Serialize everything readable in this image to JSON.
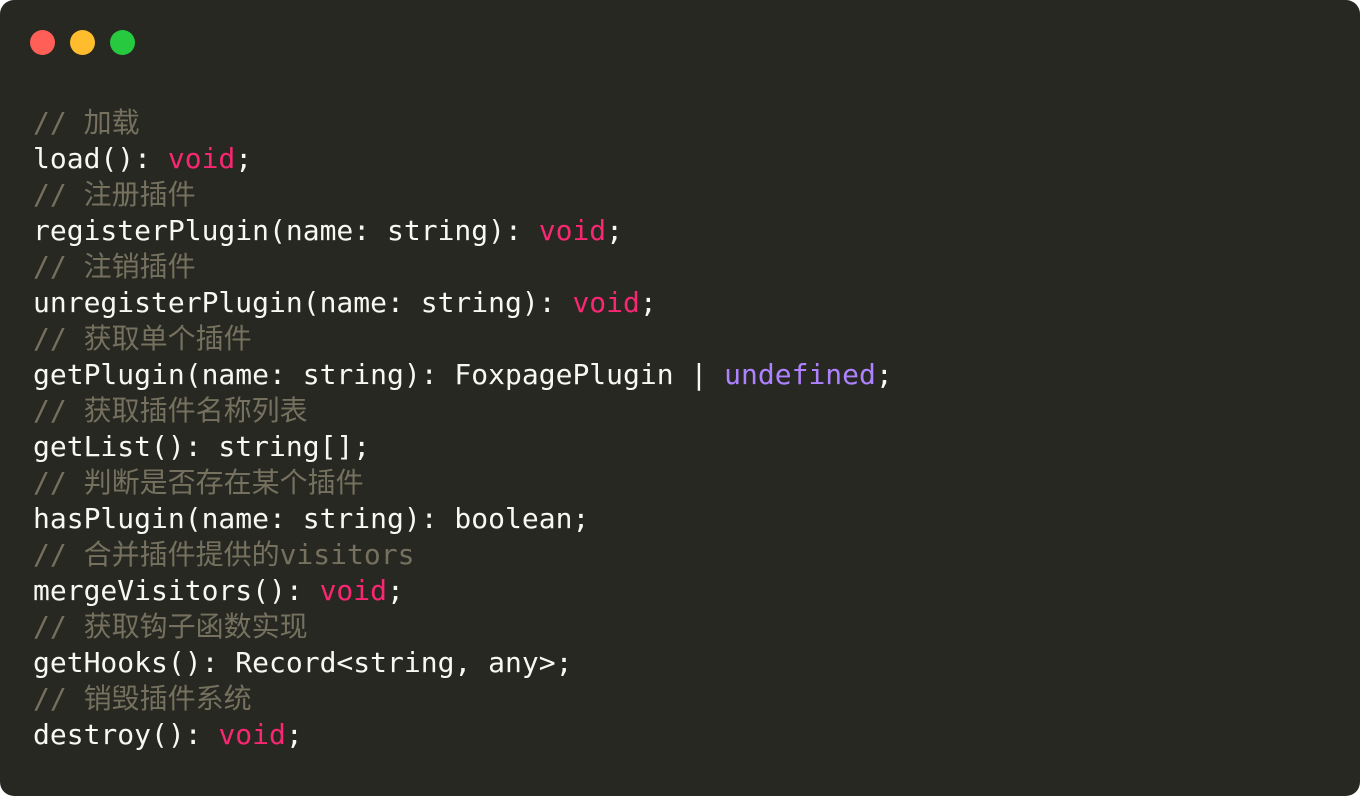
{
  "window": {
    "background": "#272822",
    "buttons": [
      {
        "name": "close",
        "color": "#ff5f56"
      },
      {
        "name": "minimize",
        "color": "#ffbd2e"
      },
      {
        "name": "zoom",
        "color": "#27c93f"
      }
    ]
  },
  "colors": {
    "plain": "#f8f8f2",
    "comment": "#75715e",
    "keyword": "#f92672",
    "constant": "#ae81ff"
  },
  "code": {
    "lines": [
      [
        {
          "t": "// 加载",
          "c": "comment"
        }
      ],
      [
        {
          "t": "load(): ",
          "c": "plain"
        },
        {
          "t": "void",
          "c": "keyword"
        },
        {
          "t": ";",
          "c": "plain"
        }
      ],
      [
        {
          "t": "// 注册插件",
          "c": "comment"
        }
      ],
      [
        {
          "t": "registerPlugin(name: string): ",
          "c": "plain"
        },
        {
          "t": "void",
          "c": "keyword"
        },
        {
          "t": ";",
          "c": "plain"
        }
      ],
      [
        {
          "t": "// 注销插件",
          "c": "comment"
        }
      ],
      [
        {
          "t": "unregisterPlugin(name: string): ",
          "c": "plain"
        },
        {
          "t": "void",
          "c": "keyword"
        },
        {
          "t": ";",
          "c": "plain"
        }
      ],
      [
        {
          "t": "// 获取单个插件",
          "c": "comment"
        }
      ],
      [
        {
          "t": "getPlugin(name: string): FoxpagePlugin | ",
          "c": "plain"
        },
        {
          "t": "undefined",
          "c": "constant"
        },
        {
          "t": ";",
          "c": "plain"
        }
      ],
      [
        {
          "t": "// 获取插件名称列表",
          "c": "comment"
        }
      ],
      [
        {
          "t": "getList(): string[];",
          "c": "plain"
        }
      ],
      [
        {
          "t": "// 判断是否存在某个插件",
          "c": "comment"
        }
      ],
      [
        {
          "t": "hasPlugin(name: string): boolean;",
          "c": "plain"
        }
      ],
      [
        {
          "t": "// 合并插件提供的visitors",
          "c": "comment"
        }
      ],
      [
        {
          "t": "mergeVisitors(): ",
          "c": "plain"
        },
        {
          "t": "void",
          "c": "keyword"
        },
        {
          "t": ";",
          "c": "plain"
        }
      ],
      [
        {
          "t": "// 获取钩子函数实现",
          "c": "comment"
        }
      ],
      [
        {
          "t": "getHooks(): Record<string, any>;",
          "c": "plain"
        }
      ],
      [
        {
          "t": "// 销毁插件系统",
          "c": "comment"
        }
      ],
      [
        {
          "t": "destroy(): ",
          "c": "plain"
        },
        {
          "t": "void",
          "c": "keyword"
        },
        {
          "t": ";",
          "c": "plain"
        }
      ]
    ]
  }
}
